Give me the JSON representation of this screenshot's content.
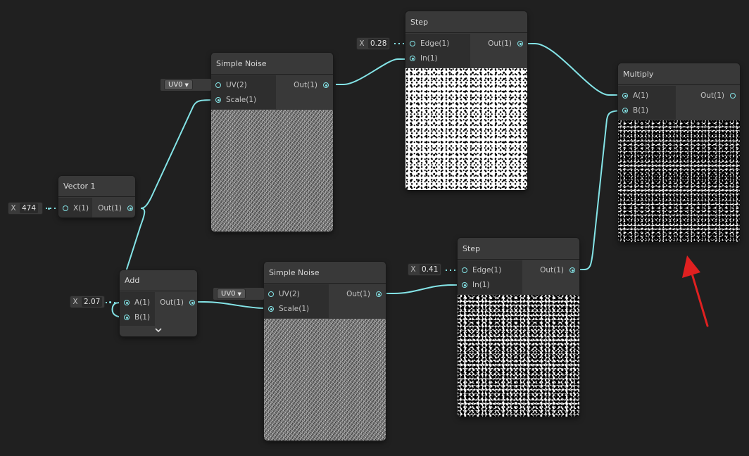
{
  "nodes": {
    "simple_noise_1": {
      "title": "Simple Noise",
      "inputs": [
        "UV(2)",
        "Scale(1)"
      ],
      "output": "Out(1)",
      "uv_dropdown": "UV0"
    },
    "simple_noise_2": {
      "title": "Simple Noise",
      "inputs": [
        "UV(2)",
        "Scale(1)"
      ],
      "output": "Out(1)",
      "uv_dropdown": "UV0"
    },
    "step_1": {
      "title": "Step",
      "inputs": [
        "Edge(1)",
        "In(1)"
      ],
      "output": "Out(1)",
      "edge_field_label": "X",
      "edge_value": "0.28"
    },
    "step_2": {
      "title": "Step",
      "inputs": [
        "Edge(1)",
        "In(1)"
      ],
      "output": "Out(1)",
      "edge_field_label": "X",
      "edge_value": "0.41"
    },
    "vector1": {
      "title": "Vector 1",
      "input": "X(1)",
      "output": "Out(1)",
      "field_label": "X",
      "value": "474"
    },
    "add": {
      "title": "Add",
      "inputs": [
        "A(1)",
        "B(1)"
      ],
      "output": "Out(1)",
      "field_label": "X",
      "b_value": "2.07",
      "expand_icon": "chevron-down-icon"
    },
    "multiply": {
      "title": "Multiply",
      "inputs": [
        "A(1)",
        "B(1)"
      ],
      "output": "Out(1)"
    }
  },
  "annotation": {
    "icon": "red-arrow-icon",
    "color": "#e02020"
  },
  "colors": {
    "background": "#202020",
    "node": "#393939",
    "wire": "#84e4e7"
  }
}
